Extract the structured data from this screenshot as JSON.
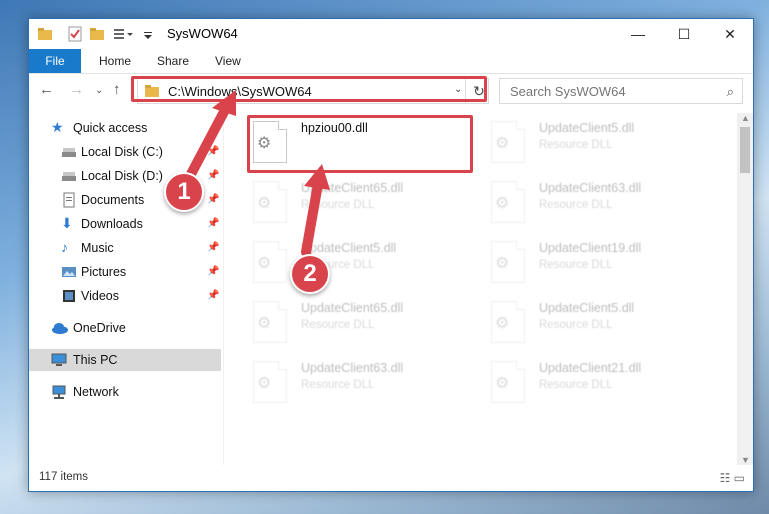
{
  "window": {
    "title": "SysWOW64",
    "controls": {
      "minimize": "—",
      "maximize": "☐",
      "close": "✕"
    }
  },
  "ribbon": {
    "tabs": [
      "File",
      "Home",
      "Share",
      "View"
    ]
  },
  "address": {
    "path": "C:\\Windows\\SysWOW64",
    "search_placeholder": "Search SysWOW64"
  },
  "sidebar": {
    "items": [
      {
        "label": "Quick access",
        "icon": "star-icon"
      },
      {
        "label": "Local Disk (C:)",
        "icon": "drive-icon",
        "pinned": true
      },
      {
        "label": "Local Disk (D:)",
        "icon": "drive-icon",
        "pinned": true
      },
      {
        "label": "Documents",
        "icon": "documents-icon",
        "pinned": true
      },
      {
        "label": "Downloads",
        "icon": "download-icon",
        "pinned": true
      },
      {
        "label": "Music",
        "icon": "music-icon",
        "pinned": true
      },
      {
        "label": "Pictures",
        "icon": "pictures-icon",
        "pinned": true
      },
      {
        "label": "Videos",
        "icon": "videos-icon",
        "pinned": true
      },
      {
        "label": "OneDrive",
        "icon": "cloud-icon"
      },
      {
        "label": "This PC",
        "icon": "computer-icon",
        "selected": true
      },
      {
        "label": "Network",
        "icon": "network-icon"
      }
    ]
  },
  "files": [
    {
      "name": "hpziou00.dll",
      "type": ""
    },
    {
      "name": "UpdateClient5.dll",
      "type": "Resource DLL"
    },
    {
      "name": "UpdateClient65.dll",
      "type": "Resource DLL"
    },
    {
      "name": "UpdateClient63.dll",
      "type": "Resource DLL"
    },
    {
      "name": "UpdateClient5.dll",
      "type": "Resource DLL"
    },
    {
      "name": "UpdateClient19.dll",
      "type": "Resource DLL"
    },
    {
      "name": "UpdateClient65.dll",
      "type": "Resource DLL"
    },
    {
      "name": "UpdateClient5.dll",
      "type": "Resource DLL"
    },
    {
      "name": "UpdateClient63.dll",
      "type": "Resource DLL"
    },
    {
      "name": "UpdateClient21.dll",
      "type": "Resource DLL"
    }
  ],
  "status": {
    "item_count": "117 items"
  },
  "annotations": {
    "step1": "1",
    "step2": "2",
    "color": "#d8434c"
  }
}
